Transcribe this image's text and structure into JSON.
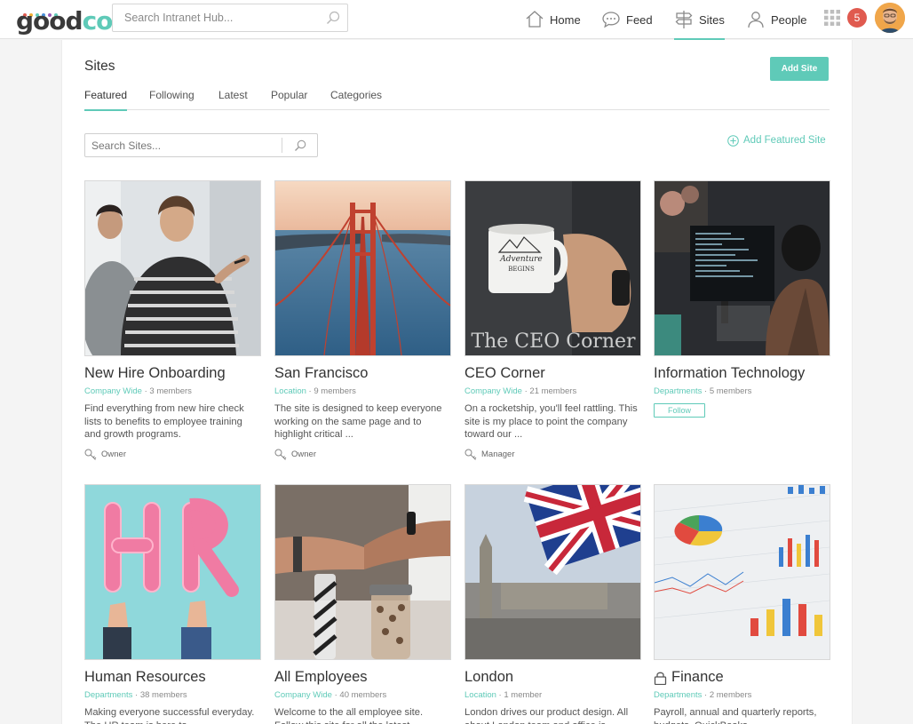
{
  "brand": {
    "logo_text_main": "good",
    "logo_text_accent": "co",
    "dot_colors": [
      "#e05a4f",
      "#f2b134",
      "#5fcab8",
      "#4a90d9",
      "#9b59b6",
      "#5fcab8"
    ]
  },
  "topbar": {
    "search_placeholder": "Search Intranet Hub...",
    "nav": [
      {
        "label": "Home",
        "icon": "home-icon"
      },
      {
        "label": "Feed",
        "icon": "chat-bubble-icon"
      },
      {
        "label": "Sites",
        "icon": "signpost-icon",
        "active": true
      },
      {
        "label": "People",
        "icon": "person-icon"
      }
    ],
    "notification_count": "5"
  },
  "page": {
    "title": "Sites",
    "add_site_label": "Add Site",
    "tabs": [
      {
        "label": "Featured",
        "active": true
      },
      {
        "label": "Following"
      },
      {
        "label": "Latest"
      },
      {
        "label": "Popular"
      },
      {
        "label": "Categories"
      }
    ],
    "search_placeholder": "Search Sites...",
    "add_featured_label": "Add Featured Site"
  },
  "sites": [
    {
      "name": "New Hire Onboarding",
      "category": "Company Wide",
      "members": "3 members",
      "description": "Find everything from new hire check lists to benefits to employee training and growth programs.",
      "role": "Owner",
      "image_icon": "whiteboard-photo"
    },
    {
      "name": "San Francisco",
      "category": "Location",
      "members": "9 members",
      "description": "The site is designed to keep everyone working on the same page and to highlight critical ...",
      "role": "Owner",
      "image_icon": "golden-gate-photo"
    },
    {
      "name": "CEO Corner",
      "category": "Company Wide",
      "members": "21 members",
      "description": "On a rocketship, you'll feel rattling. This site is my place to point the company toward our ...",
      "role": "Manager",
      "image_icon": "coffee-mug-photo",
      "image_caption": "The CEO Corner",
      "mug_text": "Adventure BEGINS"
    },
    {
      "name": "Information Technology",
      "category": "Departments",
      "members": "5 members",
      "description": "",
      "follow_label": "Follow",
      "image_icon": "computer-desk-photo"
    },
    {
      "name": "Human Resources",
      "category": "Departments",
      "members": "38 members",
      "description": "Making everyone successful everyday. The HR team is here to",
      "image_icon": "hr-balloons-photo",
      "balloon_text": "HR"
    },
    {
      "name": "All Employees",
      "category": "Company Wide",
      "members": "40 members",
      "description": "Welcome to the all employee site. Follow this site for all the latest",
      "image_icon": "fist-bump-photo"
    },
    {
      "name": "London",
      "category": "Location",
      "members": "1 member",
      "description": "London drives our product design. All about London team and office is",
      "image_icon": "union-jack-photo"
    },
    {
      "name": "Finance",
      "category": "Departments",
      "members": "2 members",
      "description": "Payroll, annual and quarterly reports, budgets, QuickBooks",
      "locked": true,
      "image_icon": "charts-photo"
    }
  ]
}
